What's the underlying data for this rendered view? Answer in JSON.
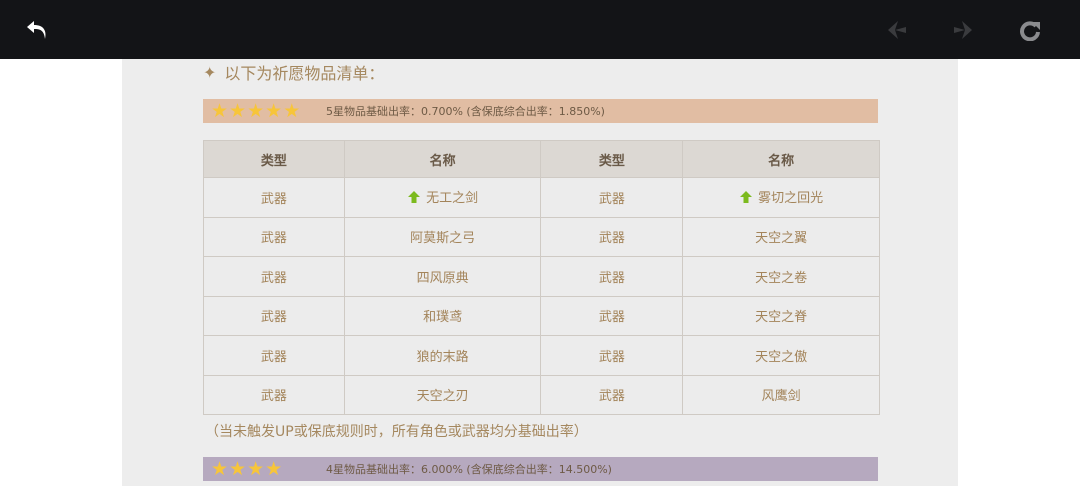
{
  "toolbar": {
    "back_icon": "back-arrow-icon",
    "nav_prev_icon": "prev-icon",
    "nav_next_icon": "next-icon",
    "refresh_icon": "refresh-icon"
  },
  "heading": "以下为祈愿物品清单：",
  "five_star": {
    "stars": 5,
    "text": "5星物品基础出率：0.700% (含保底综合出率：1.850%)",
    "color": "#e1bda3"
  },
  "table": {
    "headers": [
      "类型",
      "名称",
      "类型",
      "名称"
    ],
    "rows": [
      {
        "t1": "武器",
        "n1": "无工之剑",
        "up1": true,
        "t2": "武器",
        "n2": "雾切之回光",
        "up2": true
      },
      {
        "t1": "武器",
        "n1": "阿莫斯之弓",
        "t2": "武器",
        "n2": "天空之翼"
      },
      {
        "t1": "武器",
        "n1": "四风原典",
        "t2": "武器",
        "n2": "天空之卷"
      },
      {
        "t1": "武器",
        "n1": "和璞鸢",
        "t2": "武器",
        "n2": "天空之脊"
      },
      {
        "t1": "武器",
        "n1": "狼的末路",
        "t2": "武器",
        "n2": "天空之傲"
      },
      {
        "t1": "武器",
        "n1": "天空之刃",
        "t2": "武器",
        "n2": "风鹰剑"
      }
    ]
  },
  "note": "（当未触发UP或保底规则时，所有角色或武器均分基础出率）",
  "four_star": {
    "stars": 4,
    "text": "4星物品基础出率：6.000% (含保底综合出率：14.500%)",
    "color": "#b6a9bf"
  }
}
